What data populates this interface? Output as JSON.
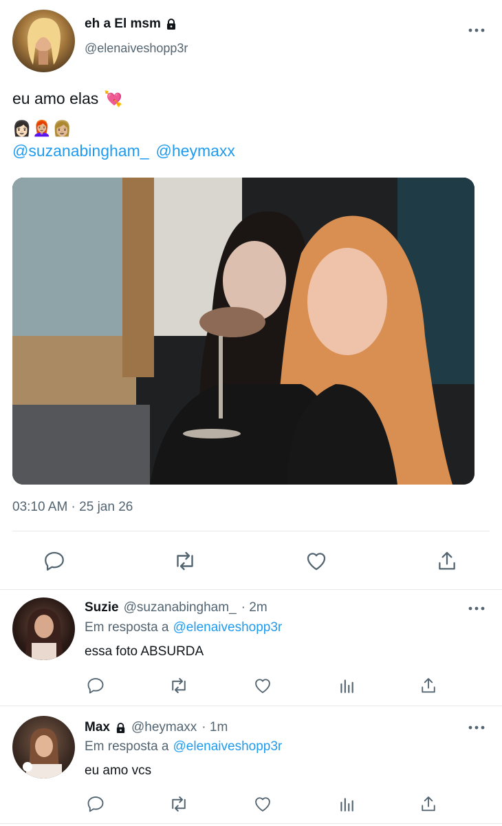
{
  "tweet": {
    "display_name": "eh a El msm",
    "handle": "@elenaiveshopp3r",
    "text": "eu amo elas",
    "emoji_line1": "💘",
    "emoji_line2": "👩🏻👩🏼‍🦰👩🏼",
    "mentions": [
      "@suzanabingham_",
      "@heymaxx"
    ],
    "timestamp": "03:10 AM · 25 jan 26"
  },
  "replies": [
    {
      "display_name": "Suzie",
      "handle": "@suzanabingham_",
      "time": "· 2m",
      "reply_to_prefix": "Em resposta a",
      "reply_to_handle": "@elenaiveshopp3r",
      "text": "essa foto ABSURDA",
      "locked": false
    },
    {
      "display_name": "Max",
      "handle": "@heymaxx",
      "time": "· 1m",
      "reply_to_prefix": "Em resposta a",
      "reply_to_handle": "@elenaiveshopp3r",
      "text": "eu amo vcs",
      "locked": true
    }
  ],
  "colors": {
    "accent": "#1d9bf0",
    "muted": "#536471",
    "text": "#0f1419",
    "divider": "#e6e9ec"
  },
  "icons": [
    "more-icon",
    "lock-icon",
    "reply-icon",
    "retweet-icon",
    "like-icon",
    "share-icon",
    "analytics-icon"
  ]
}
